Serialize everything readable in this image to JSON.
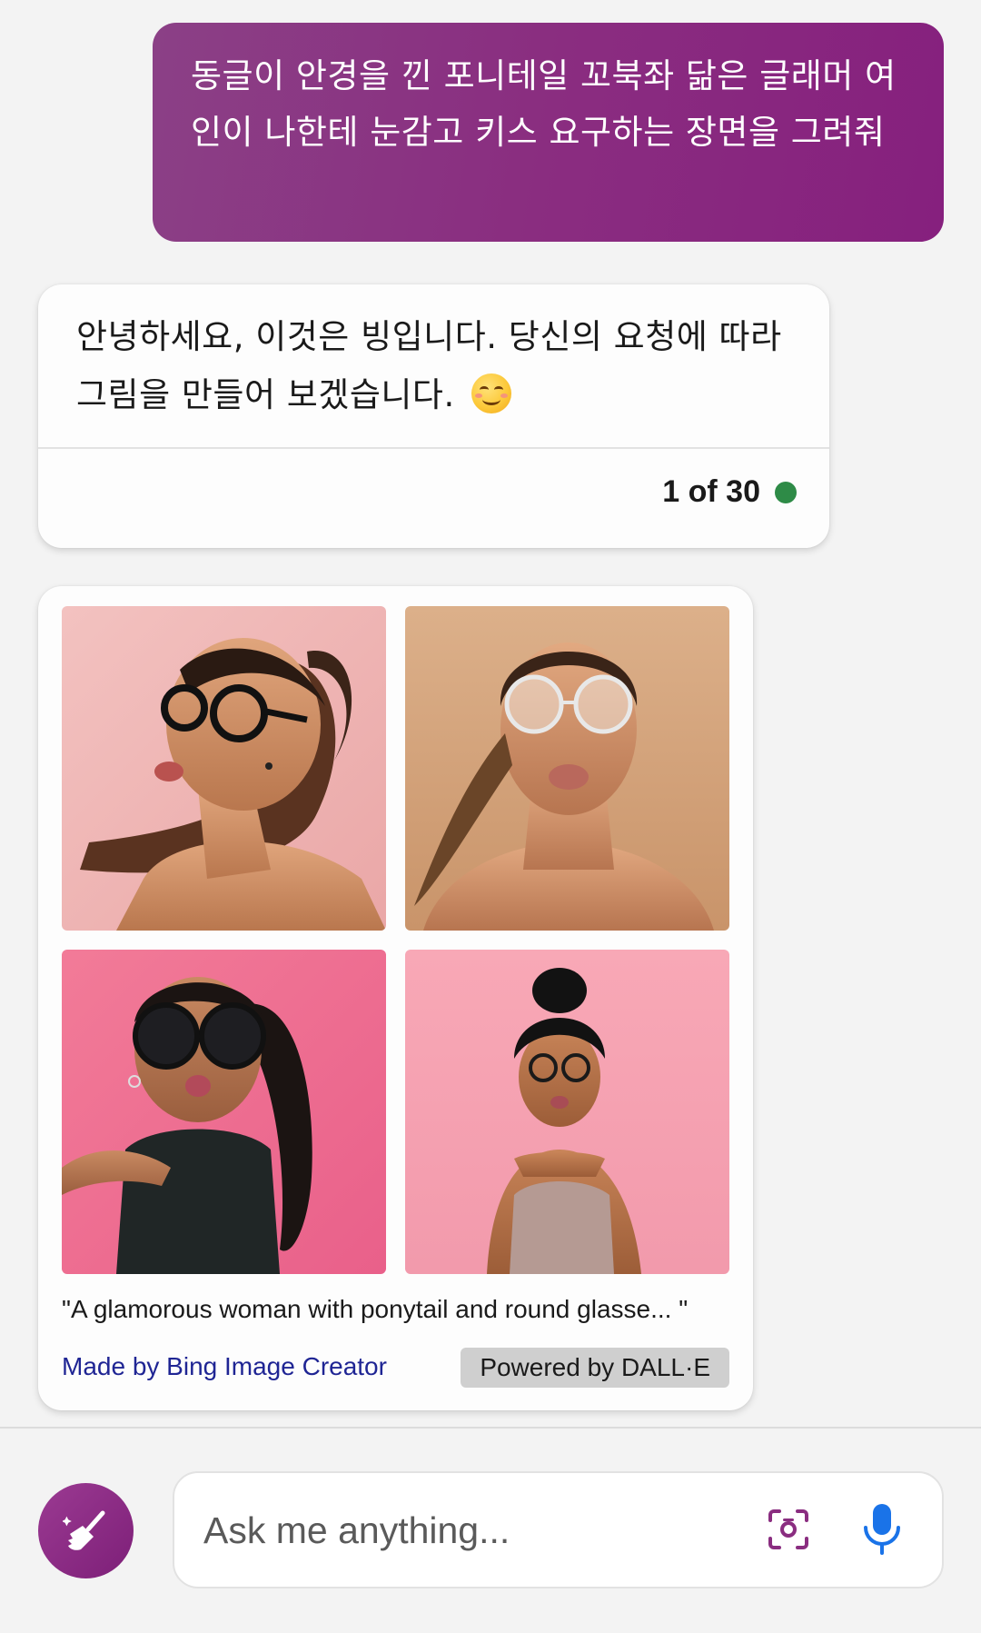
{
  "user_message": {
    "text": "동글이 안경을 낀 포니테일 꼬북좌 닮은 글래머 여인이 나한테 눈감고 키스 요구하는 장면을 그려줘"
  },
  "bot_message": {
    "text": "안녕하세요, 이것은 빙입니다. 당신의 요청에 따라 그림을 만들어 보겠습니다.",
    "emoji": "smiling-face-icon",
    "counter": "1 of 30",
    "status_color": "#2e8b47"
  },
  "image_result": {
    "images": [
      {
        "name": "generated-image-1",
        "background": "#f2b8b8"
      },
      {
        "name": "generated-image-2",
        "background": "#d9a880"
      },
      {
        "name": "generated-image-3",
        "background": "#ef6f8e"
      },
      {
        "name": "generated-image-4",
        "background": "#f6a7b6"
      }
    ],
    "caption": "\"A glamorous woman with ponytail and round glasse... \"",
    "made_by": "Made by Bing Image Creator",
    "powered_by": "Powered by DALL·E"
  },
  "composer": {
    "placeholder": "Ask me anything...",
    "new_topic_icon": "broom-icon",
    "camera_icon": "visual-search-icon",
    "mic_icon": "microphone-icon"
  },
  "colors": {
    "accent": "#8a2d80",
    "link": "#1f2594",
    "mic": "#1a73e8"
  }
}
